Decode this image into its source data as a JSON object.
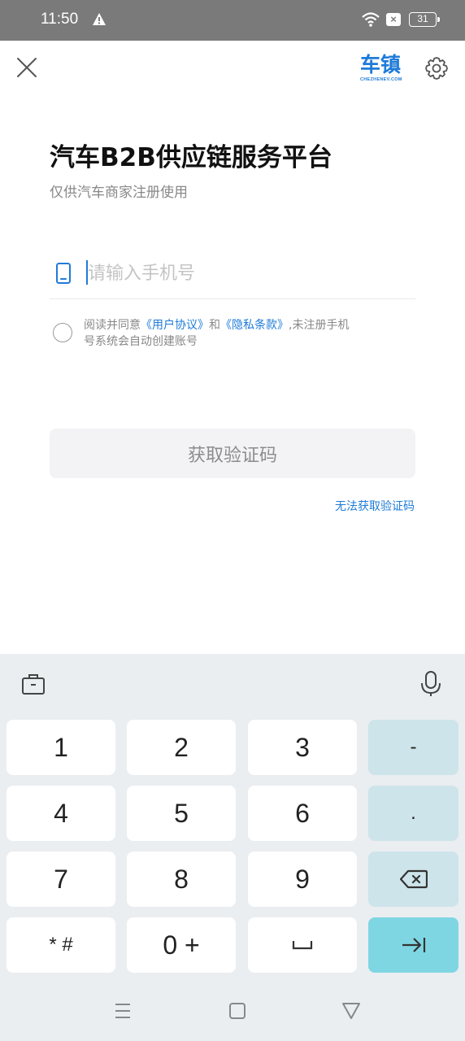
{
  "status_bar": {
    "time": "11:50",
    "battery": "31",
    "icons": [
      "warning-icon",
      "wifi-icon",
      "sim-blocked-icon",
      "battery-icon"
    ]
  },
  "header": {
    "logo_text": "车镇",
    "logo_subtext": "CHEZHENEV.COM"
  },
  "main": {
    "title": "汽车B2B供应链服务平台",
    "subtitle": "仅供汽车商家注册使用",
    "phone_input": {
      "value": "",
      "placeholder": "请输入手机号"
    },
    "agreement": {
      "prefix": "阅读并同意",
      "user_agreement": "《用户协议》",
      "and": "和",
      "privacy_terms": "《隐私条款》",
      "suffix": ",未注册手机号系统会自动创建账号"
    },
    "get_code_button": "获取验证码",
    "no_code_link": "无法获取验证码"
  },
  "keyboard": {
    "keys": {
      "k1": "1",
      "k2": "2",
      "k3": "3",
      "minus": "-",
      "k4": "4",
      "k5": "5",
      "k6": "6",
      "dot": ".",
      "k7": "7",
      "k8": "8",
      "k9": "9",
      "star_hash": "* #",
      "zero_plus": "0 +"
    }
  },
  "colors": {
    "accent": "#1f7bd8",
    "status_bar": "#7a7a7a",
    "keyboard_bg": "#eaeef1",
    "side_key": "#cde4ea",
    "next_key": "#7fd6e3"
  }
}
